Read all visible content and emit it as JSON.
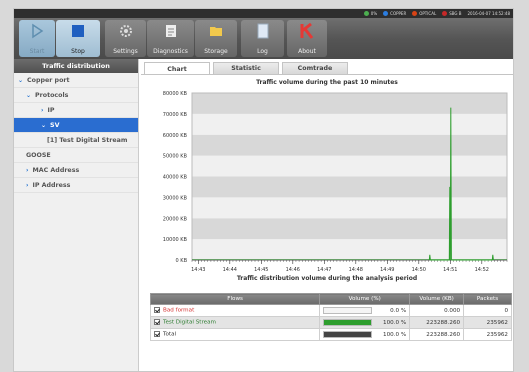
{
  "status": {
    "items": [
      {
        "label": "0%",
        "color": "#4caf50"
      },
      {
        "label": "COPPER",
        "color": "#2b7de0"
      },
      {
        "label": "OPTICAL",
        "color": "#d84315"
      },
      {
        "label": "SBG B",
        "color": "#c62828"
      }
    ],
    "datetime": "2016-04-07 14:52:48"
  },
  "toolbar": {
    "start": "Start",
    "stop": "Stop",
    "settings": "Settings",
    "diagnostics": "Diagnostics",
    "storage": "Storage",
    "log": "Log",
    "about": "About"
  },
  "sidebar": {
    "title": "Traffic distribution",
    "items": [
      {
        "label": "Copper port",
        "chev": "⌄"
      },
      {
        "label": "Protocols",
        "chev": "⌄"
      },
      {
        "label": "IP",
        "chev": "›"
      },
      {
        "label": "SV",
        "chev": "⌄"
      },
      {
        "label": "[1] Test Digital Stream",
        "chev": ""
      },
      {
        "label": "GOOSE",
        "chev": ""
      },
      {
        "label": "MAC Address",
        "chev": "›"
      },
      {
        "label": "IP Address",
        "chev": "›"
      }
    ]
  },
  "tabs": [
    "Chart",
    "Statistic",
    "Comtrade"
  ],
  "chart_data": {
    "type": "line",
    "title": "Traffic volume during the past 10 minutes",
    "y_ticks": [
      "0 KB",
      "10000 KB",
      "20000 KB",
      "30000 KB",
      "40000 KB",
      "50000 KB",
      "60000 KB",
      "70000 KB",
      "80000 KB"
    ],
    "x_ticks": [
      "14:43",
      "14:44",
      "14:45",
      "14:46",
      "14:47",
      "14:48",
      "14:49",
      "14:50",
      "14:51",
      "14:52"
    ],
    "ylim": [
      0,
      80000
    ],
    "series": [
      {
        "color": "#2e9e2e",
        "points": [
          [
            "14:50:20",
            0
          ],
          [
            "14:50:21",
            2500
          ],
          [
            "14:50:22",
            0
          ],
          [
            "14:50:58",
            0
          ],
          [
            "14:50:59",
            35000
          ],
          [
            "14:51:00",
            0
          ],
          [
            "14:51:00",
            0
          ],
          [
            "14:51:01",
            73000
          ],
          [
            "14:51:02",
            0
          ],
          [
            "14:52:20",
            0
          ],
          [
            "14:52:21",
            2500
          ],
          [
            "14:52:22",
            0
          ]
        ]
      }
    ]
  },
  "table": {
    "title": "Traffic distribution volume during the analysis period",
    "headers": [
      "Flows",
      "Volume (%)",
      "Volume (KB)",
      "Packets"
    ],
    "rows": [
      {
        "name": "Bad format",
        "name_color": "#d32f2f",
        "pct": "0.0 %",
        "pct_value": 0,
        "bar_color": "#2e9e2e",
        "kb": "0.000",
        "packets": "0"
      },
      {
        "name": "Test Digital Stream",
        "name_color": "#2e7d32",
        "pct": "100.0 %",
        "pct_value": 100,
        "bar_color": "#2e9e2e",
        "kb": "223288.260",
        "packets": "235962"
      },
      {
        "name": "Total",
        "name_color": "#333333",
        "pct": "100.0 %",
        "pct_value": 100,
        "bar_color": "#444444",
        "kb": "223288.260",
        "packets": "235962"
      }
    ]
  }
}
